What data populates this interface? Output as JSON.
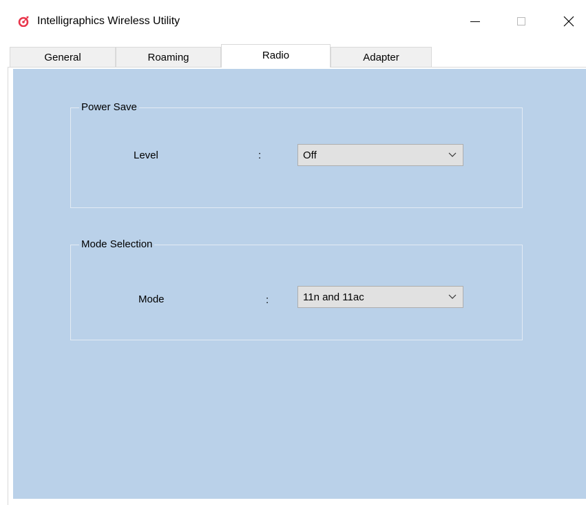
{
  "window": {
    "title": "Intelligraphics Wireless Utility",
    "app_icon": "target-icon",
    "controls": {
      "minimize": "minimize-icon",
      "maximize": "maximize-icon",
      "close": "close-icon"
    }
  },
  "tabs": [
    {
      "label": "General",
      "active": false
    },
    {
      "label": "Roaming",
      "active": false
    },
    {
      "label": "Radio",
      "active": true
    },
    {
      "label": "Adapter",
      "active": false
    }
  ],
  "power_save": {
    "group_title": "Power Save",
    "level_label": "Level",
    "separator": ":",
    "level_value": "Off"
  },
  "mode_selection": {
    "group_title": "Mode Selection",
    "mode_label": "Mode",
    "separator": ":",
    "mode_value": "11n and 11ac"
  },
  "colors": {
    "panel_background": "#bad1e9",
    "app_icon_red": "#e8344a"
  }
}
